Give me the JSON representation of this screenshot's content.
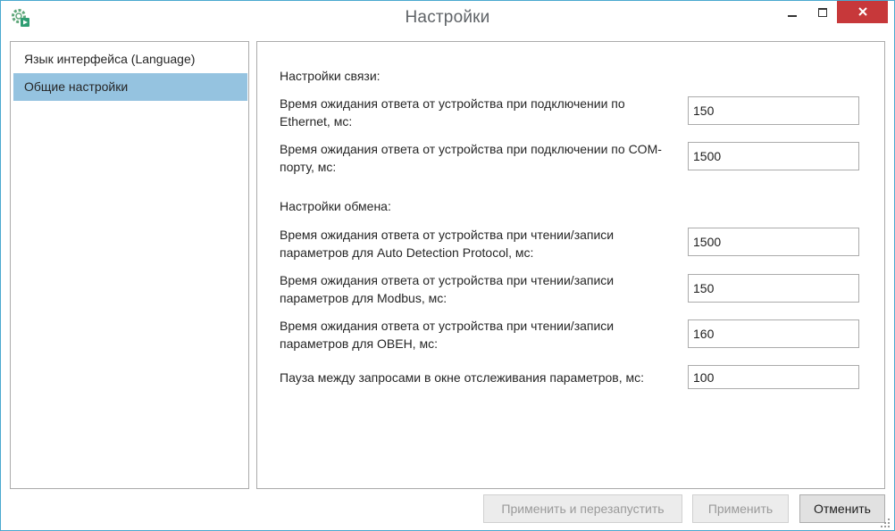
{
  "window": {
    "title": "Настройки"
  },
  "sidebar": {
    "items": [
      {
        "label": "Язык интерфейса (Language)"
      },
      {
        "label": "Общие настройки"
      }
    ]
  },
  "main": {
    "connection_section": "Настройки связи:",
    "ethernet_label": "Время ожидания ответа от устройства при подключении по Ethernet, мс:",
    "ethernet_value": "150",
    "com_label": "Время ожидания ответа от устройства при подключении по COM-порту, мс:",
    "com_value": "1500",
    "exchange_section": "Настройки обмена:",
    "adp_label": "Время ожидания ответа от устройства при чтении/записи параметров для Auto Detection Protocol, мс:",
    "adp_value": "1500",
    "modbus_label": "Время ожидания ответа от устройства при чтении/записи параметров для Modbus, мс:",
    "modbus_value": "150",
    "owen_label": "Время ожидания ответа от устройства при чтении/записи параметров для ОВЕН, мс:",
    "owen_value": "160",
    "pause_label": "Пауза между запросами в окне отслеживания параметров, мс:",
    "pause_value": "100"
  },
  "footer": {
    "apply_restart_label": "Применить и перезапустить",
    "apply_label": "Применить",
    "cancel_label": "Отменить"
  },
  "colors": {
    "selection": "#95c3e0",
    "close_button": "#c7383a",
    "window_border": "#4aa8cf"
  },
  "icons": [
    "settings-app-icon",
    "minimize-icon",
    "maximize-icon",
    "close-icon",
    "resize-grip-icon"
  ]
}
